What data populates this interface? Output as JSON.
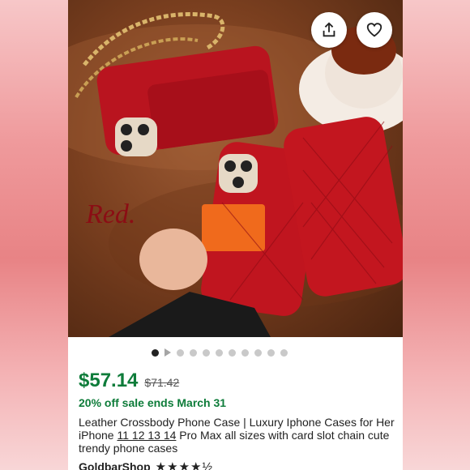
{
  "photo": {
    "overlay_text": "Red."
  },
  "actions": {
    "share_icon": "share-icon",
    "favorite_icon": "heart-icon"
  },
  "carousel": {
    "dot_count": 10,
    "active_index": 0
  },
  "listing": {
    "price": "$57.14",
    "original_price": "$71.42",
    "sale_text": "20% off sale ends March 31",
    "title_part1": "Leather Crossbody Phone Case | Luxury Iphone Cases for Her iPhone ",
    "title_models": "11 12 13 14",
    "title_part2": " Pro Max all sizes with card slot chain cute trendy phone cases",
    "shop_name": "GoldbarShop",
    "rating_stars": "★★★★½",
    "price_color": "#0e7c3a"
  }
}
